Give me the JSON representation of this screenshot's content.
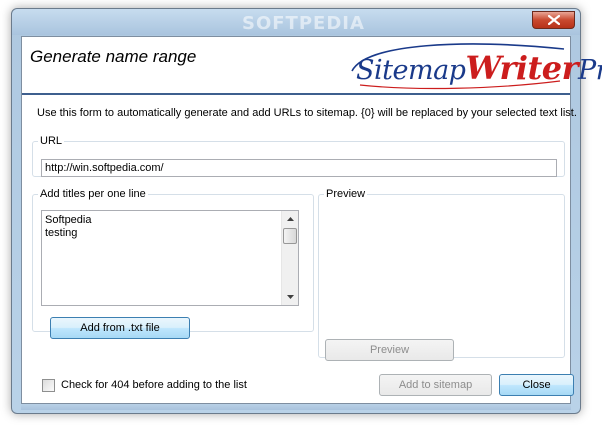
{
  "window": {
    "watermark": "SOFTPEDIA",
    "close_icon": "close-x-icon"
  },
  "header": {
    "title": "Generate name range",
    "logo_part1": "Sitemap",
    "logo_part2": "Writer",
    "logo_part3": "Pro"
  },
  "description": "Use this form to automatically generate and add URLs to sitemap. {0} will be replaced by your selected text list.",
  "url_group": {
    "legend": "URL",
    "value": "http://win.softpedia.com/"
  },
  "titles_group": {
    "legend": "Add titles per one line",
    "lines": [
      "Softpedia",
      "testing"
    ],
    "add_button": "Add from .txt file"
  },
  "preview_group": {
    "legend": "Preview",
    "preview_button": "Preview"
  },
  "footer": {
    "check_label": "Check for 404 before adding to the list",
    "check_checked": false,
    "add_button": "Add to sitemap",
    "close_button": "Close"
  },
  "colors": {
    "header_rule": "#3e5f8e",
    "logo_blue": "#1a3a8a",
    "logo_red": "#cc1d1d",
    "close_red": "#c9492f"
  }
}
